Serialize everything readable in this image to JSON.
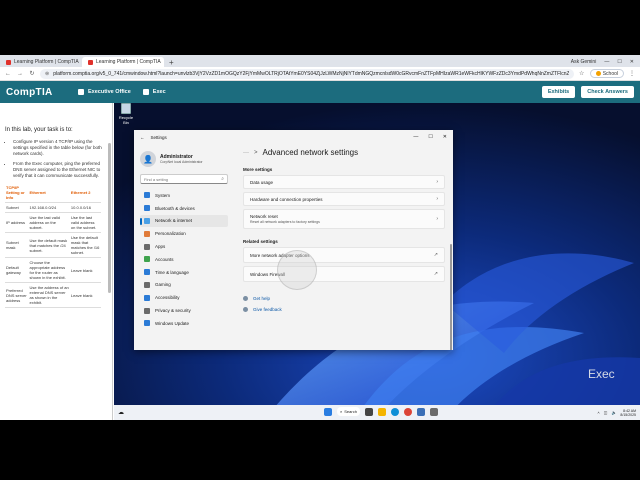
{
  "browser": {
    "tabs": [
      {
        "title": "Learning Platform | CompTIA",
        "active": false
      },
      {
        "title": "Learning Platform | CompTIA",
        "active": true
      }
    ],
    "new_tab": "+",
    "top_right": {
      "gemini": "Ask Gemini"
    },
    "url": "platform.comptia.org/v5_0_741/cmwindow.html?launch=unvlzb3VjY2VzZD1mOGQzY2FjYmMwOLTRjOTAtYmE0YS04ZjJzLWMzNjNlYTdmNGQzmcnlsdW0cGRvcmFnZTFpMHIzaWR1eWFkcHlKYWFzZDc3YmdPdWhqNnZmZTFlcnZ0YzcnkMdPKwZTEtNnbnlcmNx",
    "school_label": "School"
  },
  "comptia": {
    "logo": "CompTIA",
    "tabs": [
      {
        "label": "Executive Office"
      },
      {
        "label": "Exec"
      }
    ],
    "buttons": {
      "exhibits": "Exhibits",
      "check_answers": "Check Answers"
    }
  },
  "instructions": {
    "title": "In this lab, your task is to:",
    "bullets": [
      "Configure IP version 4 TCP/IP using the settings specified in the table below (for both network cards).",
      "From the Exec computer, ping the preferred DNS server assigned to the Ethernet NIC to verify that it can communicate successfully."
    ],
    "table": {
      "headers": [
        "TCP/IP Setting or Info",
        "Ethernet",
        "Ethernet 2"
      ],
      "rows": [
        [
          "Subnet",
          "192.168.0.0/24",
          "10.0.0.0/16"
        ],
        [
          "IP address",
          "Use the last valid address on the subnet.",
          "Use the last valid address on the subnet."
        ],
        [
          "Subnet mask",
          "Use the default mask that matches the /24 subnet.",
          "Use the default mask that matches the /16 subnet."
        ],
        [
          "Default gateway",
          "Choose the appropriate address for the router as shown in the exhibit.",
          "Leave blank"
        ],
        [
          "Preferred DNS server address",
          "Use the address of an external DNS server as shown in the exhibit.",
          "Leave blank"
        ]
      ]
    }
  },
  "desktop": {
    "recycle_bin": "Recycle Bin",
    "watermark": "Exec"
  },
  "settings": {
    "window_title": "Settings",
    "user": {
      "name": "Administrator",
      "sub": "CorpNet local Administrator"
    },
    "search_placeholder": "Find a setting",
    "nav": [
      {
        "label": "System",
        "color": "#2b7bd6"
      },
      {
        "label": "Bluetooth & devices",
        "color": "#2b7bd6"
      },
      {
        "label": "Network & internet",
        "color": "#4aa0e6",
        "active": true
      },
      {
        "label": "Personalization",
        "color": "#e07b39"
      },
      {
        "label": "Apps",
        "color": "#6a6a6a"
      },
      {
        "label": "Accounts",
        "color": "#3fa34d"
      },
      {
        "label": "Time & language",
        "color": "#2b7bd6"
      },
      {
        "label": "Gaming",
        "color": "#6a6a6a"
      },
      {
        "label": "Accessibility",
        "color": "#2b7bd6"
      },
      {
        "label": "Privacy & security",
        "color": "#6a6a6a"
      },
      {
        "label": "Windows Update",
        "color": "#2b7bd6"
      }
    ],
    "breadcrumb_dots": "···",
    "breadcrumb_sep": ">",
    "page_title": "Advanced network settings",
    "more_settings_label": "More settings",
    "more_settings": [
      {
        "label": "Data usage"
      },
      {
        "label": "Hardware and connection properties"
      },
      {
        "label": "Network reset",
        "sub": "Reset all network adapters to factory settings"
      }
    ],
    "related_label": "Related settings",
    "related": [
      {
        "label": "More network adapter options"
      },
      {
        "label": "Windows Firewall"
      }
    ],
    "links": [
      {
        "label": "Get help"
      },
      {
        "label": "Give feedback"
      }
    ]
  },
  "taskbar": {
    "search": "Search",
    "time": "8:42 AM",
    "date": "8/15/2025"
  }
}
